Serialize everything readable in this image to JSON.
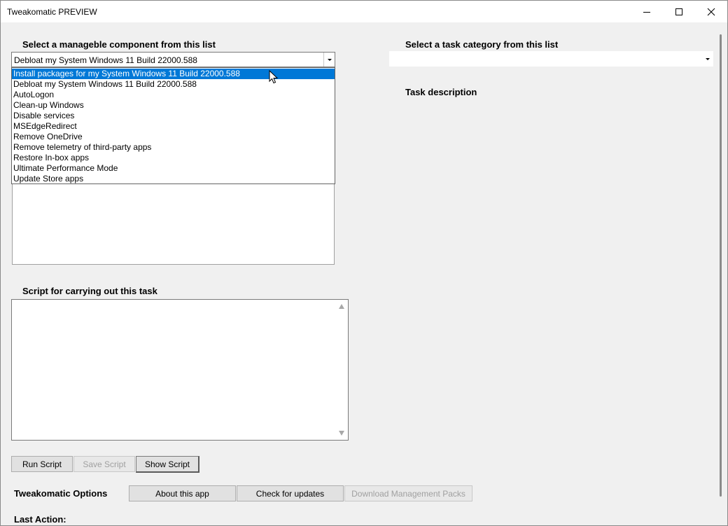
{
  "window": {
    "title": "Tweakomatic PREVIEW"
  },
  "left": {
    "component_label": "Select a manageble component from this list",
    "component_selected": "Debloat my System Windows 11 Build 22000.588",
    "dropdown_items": [
      "Install packages for my System Windows 11 Build 22000.588",
      "Debloat my System Windows 11 Build 22000.588",
      "AutoLogon",
      "Clean-up Windows",
      "Disable services",
      "MSEdgeRedirect",
      "Remove OneDrive",
      "Remove telemetry of third-party apps",
      "Restore In-box apps",
      "Ultimate Performance Mode",
      "Update Store apps"
    ],
    "dropdown_highlighted_index": 0,
    "script_label": "Script for carrying out this task"
  },
  "right": {
    "category_label": "Select a task category from this list",
    "category_selected": "",
    "description_label": "Task description"
  },
  "buttons": {
    "run_script": "Run Script",
    "save_script": "Save Script",
    "show_script": "Show Script"
  },
  "options": {
    "label": "Tweakomatic Options",
    "about": "About this app",
    "check_updates": "Check for updates",
    "download_packs": "Download Management Packs"
  },
  "status": {
    "last_action_label": "Last Action:",
    "last_action_value": ""
  },
  "colors": {
    "selection": "#0078d7",
    "disabled_text": "#a0a0a0"
  }
}
